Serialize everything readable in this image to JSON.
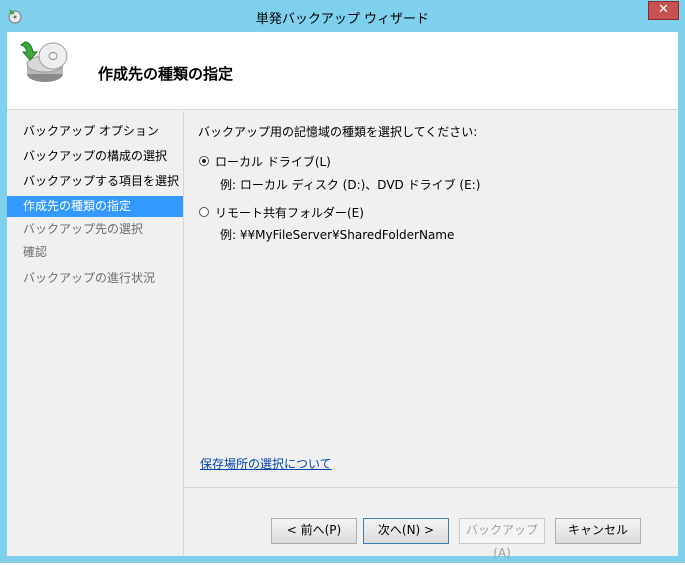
{
  "window": {
    "title": "単発バックアップ ウィザード",
    "close_glyph": "✕"
  },
  "header": {
    "title": "作成先の種類の指定"
  },
  "steps": [
    {
      "label": "バックアップ オプション",
      "state": "done"
    },
    {
      "label": "バックアップの構成の選択",
      "state": "done"
    },
    {
      "label": "バックアップする項目を選択",
      "state": "done"
    },
    {
      "label": "作成先の種類の指定",
      "state": "current"
    },
    {
      "label": "バックアップ先の選択",
      "state": "future"
    },
    {
      "label": "確認",
      "state": "future"
    },
    {
      "label": "バックアップの進行状況",
      "state": "future"
    }
  ],
  "main": {
    "prompt": "バックアップ用の記憶域の種類を選択してください:",
    "options": [
      {
        "label": "ローカル ドライブ(L)",
        "example": "例: ローカル ディスク (D:)、DVD ドライブ (E:)",
        "selected": true
      },
      {
        "label": "リモート共有フォルダー(E)",
        "example": "例: ¥¥MyFileServer¥SharedFolderName",
        "selected": false
      }
    ],
    "help_link": "保存場所の選択について"
  },
  "buttons": {
    "prev": "< 前へ(P)",
    "next": "次へ(N) >",
    "backup": "バックアップ(A)",
    "cancel": "キャンセル"
  },
  "colors": {
    "titlebar": "#7fd0ec",
    "selection": "#3399ff",
    "close": "#c75050"
  }
}
